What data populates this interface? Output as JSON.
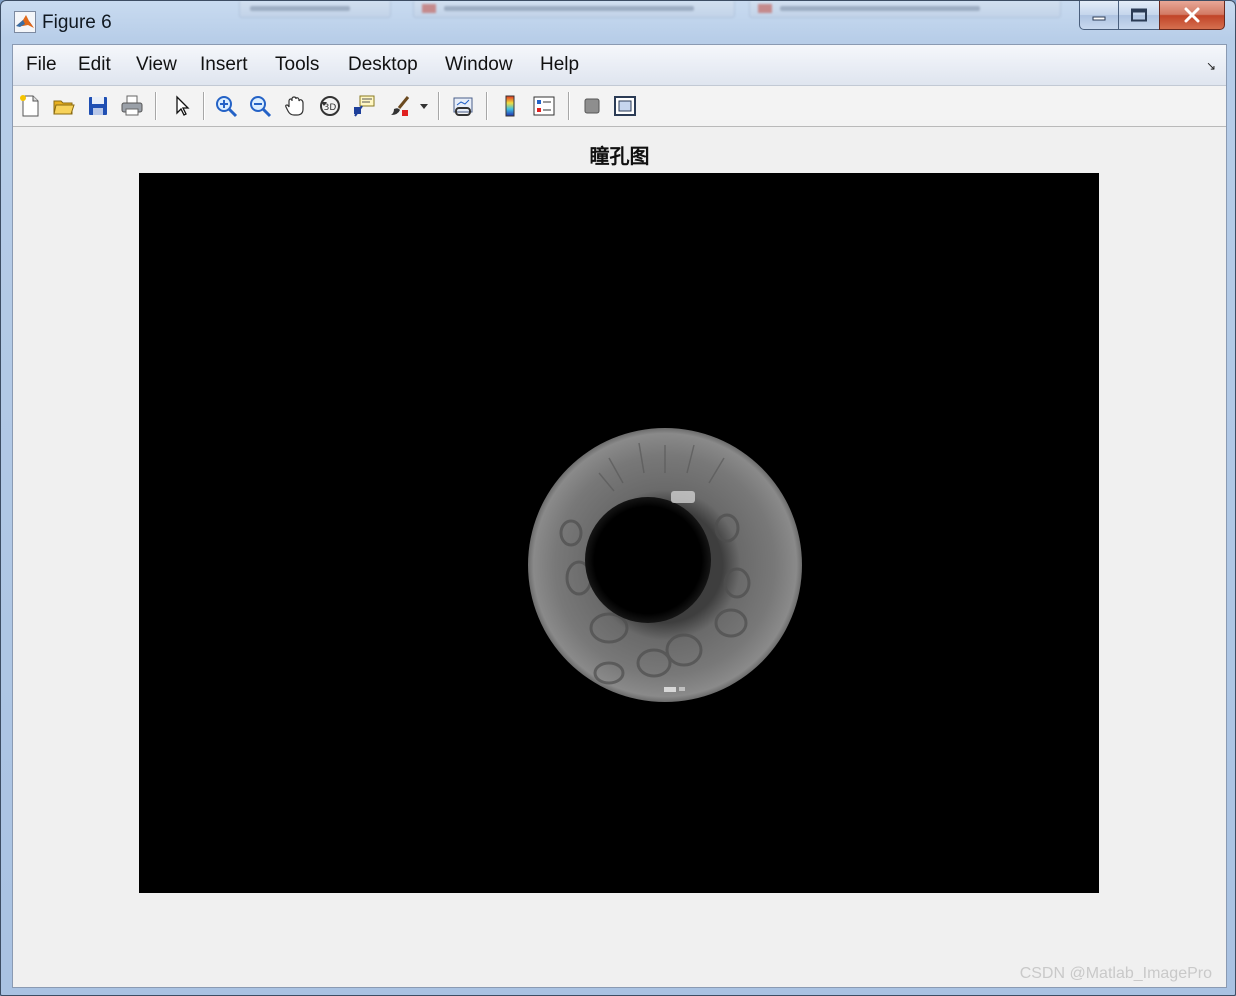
{
  "window": {
    "title": "Figure 6",
    "caption_buttons": [
      "minimize",
      "maximize",
      "close"
    ],
    "close_color": "#c9452a"
  },
  "menubar": {
    "items": [
      "File",
      "Edit",
      "View",
      "Insert",
      "Tools",
      "Desktop",
      "Window",
      "Help"
    ]
  },
  "toolbar": {
    "buttons": [
      "new-figure",
      "open-file",
      "save-figure",
      "print-figure",
      "edit-plot",
      "zoom-in",
      "zoom-out",
      "pan",
      "rotate-3d",
      "data-cursor",
      "brush",
      "brush-dropdown",
      "link-plot",
      "insert-colorbar",
      "insert-legend",
      "hide-plot-tools",
      "show-plot-tools"
    ]
  },
  "figure": {
    "title": "瞳孔图",
    "axes_background": "#000000",
    "image": {
      "description_icon": "iris-image",
      "iris_color": "#6e6e6e",
      "pupil_color": "#000000"
    }
  },
  "watermark": "CSDN @Matlab_ImagePro"
}
